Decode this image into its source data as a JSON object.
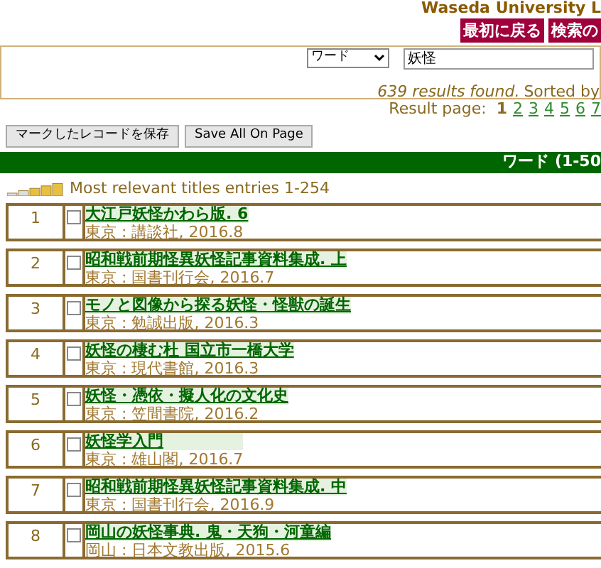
{
  "header": {
    "title": "Waseda University L",
    "buttons": [
      "最初に戻る",
      "検索の"
    ]
  },
  "search": {
    "field_select": "ワード",
    "query": "妖怪",
    "summary_count": "639 results found.",
    "summary_sort": "Sorted by"
  },
  "pagination": {
    "label": "Result page:",
    "pages": [
      {
        "label": "1",
        "selected": true
      },
      {
        "label": "2",
        "selected": false
      },
      {
        "label": "3",
        "selected": false
      },
      {
        "label": "4",
        "selected": false
      },
      {
        "label": "5",
        "selected": false
      },
      {
        "label": "6",
        "selected": false
      },
      {
        "label": "7",
        "selected": false
      }
    ]
  },
  "actions": [
    "マークしたレコードを保存",
    "Save All On Page"
  ],
  "results_bar": {
    "title": "ワード (1-50"
  },
  "relevance": {
    "label": "Most relevant titles entries 1-254"
  },
  "rows": [
    {
      "number": "1",
      "checked": false,
      "title": "大江戸妖怪かわら版. 6",
      "imprint": "東京 : 講談社, 2016.8"
    },
    {
      "number": "2",
      "checked": false,
      "title": "昭和戦前期怪異妖怪記事資料集成. 上",
      "imprint": "東京 : 国書刊行会, 2016.7"
    },
    {
      "number": "3",
      "checked": false,
      "title": "モノと図像から探る妖怪・怪獣の誕生",
      "imprint": "東京 : 勉誠出版, 2016.3"
    },
    {
      "number": "4",
      "checked": false,
      "title": "妖怪の棲む杜 国立市一橋大学",
      "imprint": "東京 : 現代書館, 2016.3"
    },
    {
      "number": "5",
      "checked": false,
      "title": "妖怪・憑依・擬人化の文化史",
      "imprint": "東京 : 笠間書院, 2016.2"
    },
    {
      "number": "6",
      "checked": false,
      "title": "妖怪学入門",
      "imprint": "東京 : 雄山閣, 2016.7"
    },
    {
      "number": "7",
      "checked": false,
      "title": "昭和戦前期怪異妖怪記事資料集成. 中",
      "imprint": "東京 : 国書刊行会, 2016.9"
    },
    {
      "number": "8",
      "checked": false,
      "title": "岡山の妖怪事典. 鬼・天狗・河童編",
      "imprint": "岡山 : 日本文教出版, 2015.6"
    }
  ]
}
